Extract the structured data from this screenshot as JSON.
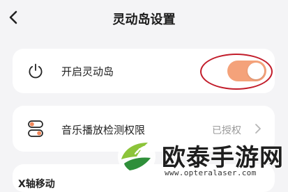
{
  "header": {
    "title": "灵动岛设置"
  },
  "settings": {
    "island_toggle": {
      "label": "开启灵动岛",
      "enabled": true,
      "on_color": "#f4a27a"
    },
    "music_permission": {
      "label": "音乐播放检测权限",
      "status": "已授权"
    },
    "x_axis": {
      "label": "X轴移动"
    }
  },
  "icons": {
    "back": "chevron-left-icon",
    "power": "power-icon",
    "switches": "toggle-switches-icon",
    "forward": "chevron-right-icon"
  },
  "annotation": {
    "color": "#c21c2a"
  },
  "watermark": {
    "title": "欧泰手游网",
    "url": "www.opteralaser.com"
  }
}
